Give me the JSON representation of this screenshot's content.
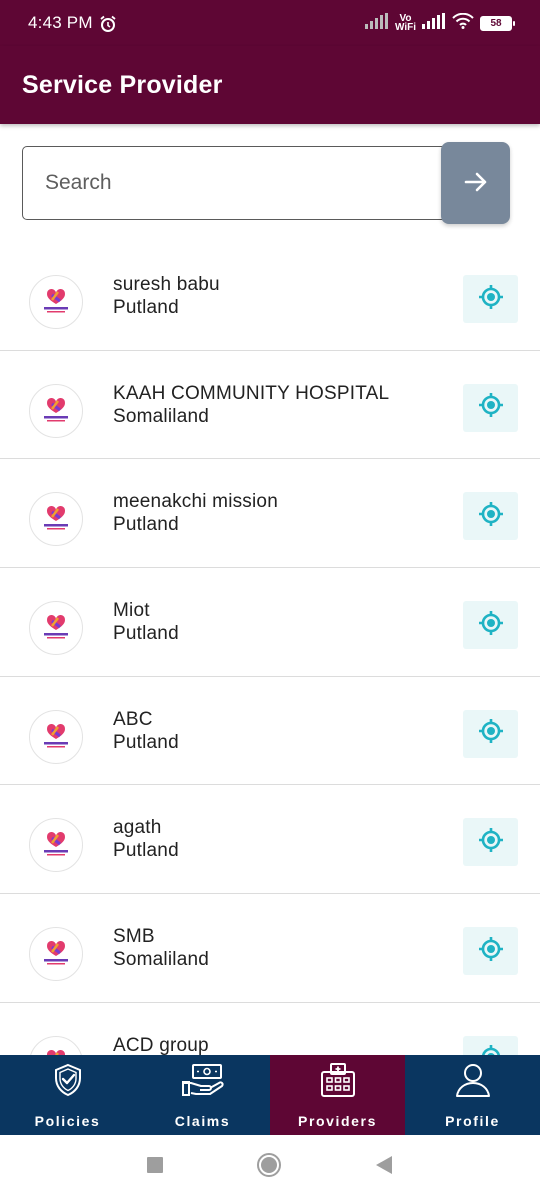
{
  "status_bar": {
    "time": "4:43 PM",
    "vowifi_top": "Vo",
    "vowifi_bottom": "WiFi",
    "battery": "58"
  },
  "header": {
    "title": "Service Provider"
  },
  "search": {
    "placeholder": "Search",
    "value": ""
  },
  "providers": [
    {
      "name": "suresh babu",
      "location": "Putland"
    },
    {
      "name": "KAAH COMMUNITY HOSPITAL",
      "location": "Somaliland"
    },
    {
      "name": "meenakchi mission",
      "location": "Putland"
    },
    {
      "name": "Miot",
      "location": "Putland"
    },
    {
      "name": "ABC",
      "location": "Putland"
    },
    {
      "name": "agath",
      "location": "Putland"
    },
    {
      "name": "SMB",
      "location": "Somaliland"
    },
    {
      "name": "ACD group",
      "location": ""
    }
  ],
  "bottom_nav": {
    "items": [
      {
        "label": "Policies",
        "icon": "shield-check-icon"
      },
      {
        "label": "Claims",
        "icon": "cash-hand-icon"
      },
      {
        "label": "Providers",
        "icon": "hospital-icon",
        "active": true
      },
      {
        "label": "Profile",
        "icon": "person-icon"
      }
    ]
  },
  "colors": {
    "brand": "#5e0634",
    "nav_background": "#0a3660",
    "search_button": "#78889b",
    "locate_icon": "#1fb3c4",
    "locate_background": "#eaf7f8"
  }
}
